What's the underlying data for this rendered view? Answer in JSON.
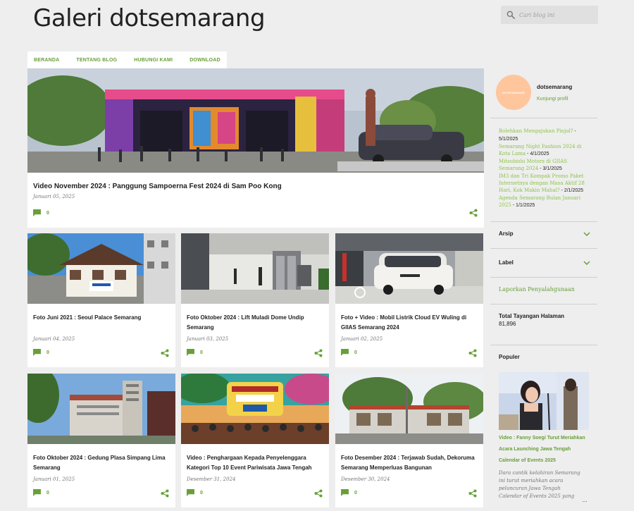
{
  "blog": {
    "title": "Galeri dotsemarang",
    "search_placeholder": "Cari blog ini"
  },
  "nav": [
    "BERANDA",
    "TENTANG BLOG",
    "HUBUNGI KAMI",
    "DOWNLOAD"
  ],
  "featured": {
    "title": "Video November 2024 : Panggung Sampoerna Fest 2024 di Sam Poo Kong",
    "date": "Januari 05, 2025",
    "comments": "0"
  },
  "posts": [
    {
      "title": "Foto Juni 2021 : Seoul Palace Semarang",
      "date": "Januari 04, 2025",
      "comments": "0"
    },
    {
      "title": "Foto Oktober 2024 : Lift Muladi Dome Undip Semarang",
      "date": "Januari 03, 2025",
      "comments": "0"
    },
    {
      "title": "Foto + Video : Mobil Listrik Cloud EV Wuling di GIIAS Semarang 2024",
      "date": "Januari 02, 2025",
      "comments": "0"
    },
    {
      "title": "Foto Oktober 2024 : Gedung Plasa Simpang Lima Semarang",
      "date": "Januari 01, 2025",
      "comments": "0"
    },
    {
      "title": "Video : Penghargaan Kepada Penyelenggara Kategori Top 10 Event Pariwisata Jawa Tengah",
      "date": "Desember 31, 2024",
      "comments": "0"
    },
    {
      "title": "Foto Desember 2024 : Terjawab Sudah, Dekoruma Semarang Memperluas Bangunan",
      "date": "Desember 30, 2024",
      "comments": "0"
    }
  ],
  "profile": {
    "avatar_text": "DOTSEMARANG",
    "name": "dotsemarang",
    "link": "Kunjungi profil"
  },
  "recent_posts": [
    {
      "title": "Bolehkan Mengajukan Pinjol?",
      "date": " - 5/1/2025"
    },
    {
      "title": "Semarang Night Fashion 2024 di Kota Lama",
      "date": " - 4/1/2025"
    },
    {
      "title": "Mitsubishi Motors di GIIAS Semarang 2024",
      "date": " - 3/1/2025"
    },
    {
      "title": "IM3 dan Tri Kompak Promo Paket Internetnya dengan Masa Aktif 28 Hari, Kok Makin Mahal?",
      "date": " - 2/1/2025"
    },
    {
      "title": "Agenda Semarang Bulan Januari 2025",
      "date": " - 1/1/2025"
    }
  ],
  "widgets": {
    "archive": "Arsip",
    "label": "Label",
    "report": "Laporkan Penyalahgunaan",
    "pageviews_label": "Total Tayangan Halaman",
    "pageviews_value": "81,896",
    "popular_label": "Populer"
  },
  "popular": {
    "title": "Video : Fanny Soegi Turut Meriahkan Acara Launching Jawa Tengah Calendar of Events 2025",
    "snippet": "Dara cantik kelahiran Semarang ini turut meriahkan acara peluncuran Jawa Tengah Calendar of Events 2025 yang",
    "ellipsis": "…"
  },
  "colors": {
    "accent": "#689f38",
    "link_light": "#8bc34a",
    "avatar": "#ffc59c",
    "background": "#eeeeee"
  }
}
